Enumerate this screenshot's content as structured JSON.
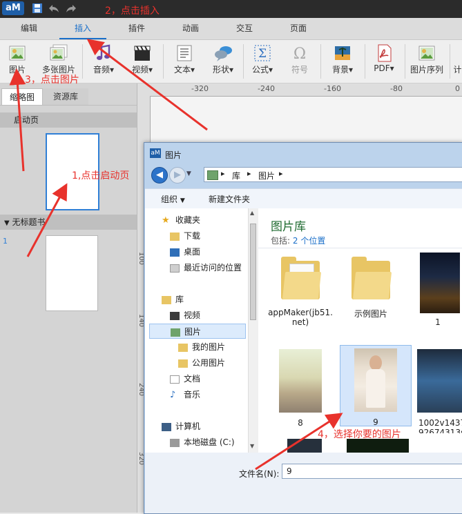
{
  "app": {
    "logo_text": "aM",
    "title_icons": [
      "save-icon",
      "undo-icon",
      "redo-icon"
    ]
  },
  "menu": {
    "tabs": [
      {
        "label": "编辑"
      },
      {
        "label": "插入",
        "active": true
      },
      {
        "label": "插件"
      },
      {
        "label": "动画"
      },
      {
        "label": "交互"
      },
      {
        "label": "页面"
      }
    ]
  },
  "ribbon": {
    "image": "图片",
    "multi_image": "多张图片",
    "audio": "音频",
    "video": "视频",
    "text": "文本",
    "shape": "形状",
    "formula": "公式",
    "symbol": "符号",
    "background": "背景",
    "pdf": "PDF",
    "image_sequence": "图片序列",
    "cut_label": "计"
  },
  "left_panel": {
    "tab_thumbs": "缩略图",
    "tab_resources": "资源库",
    "start_page": "启动页",
    "untitled_section": "无标题书",
    "page_number": "1"
  },
  "ruler": {
    "ticks": [
      "-320",
      "-240",
      "-160",
      "-80",
      "0"
    ],
    "vticks": [
      "100",
      "140",
      "240",
      "320"
    ]
  },
  "dialog": {
    "title": "图片",
    "breadcrumb": [
      "库",
      "图片"
    ],
    "organize": "组织",
    "new_folder": "新建文件夹",
    "nav": {
      "favorites": "收藏夹",
      "downloads": "下载",
      "desktop": "桌面",
      "recent": "最近访问的位置",
      "libraries": "库",
      "videos": "视频",
      "pictures": "图片",
      "my_pictures": "我的图片",
      "public_pictures": "公用图片",
      "documents": "文档",
      "music": "音乐",
      "computer": "计算机",
      "local_disk": "本地磁盘 (C:)"
    },
    "library_title": "图片库",
    "includes_label": "包括:",
    "includes_link": "2 个位置",
    "files": [
      {
        "name": "appMaker(jb51.net)",
        "name_line1": "appMaker(jb51.",
        "name_line2": "net)",
        "type": "folder"
      },
      {
        "name": "示例图片",
        "type": "folder"
      },
      {
        "name": "1",
        "type": "photo"
      },
      {
        "name": "8",
        "type": "photo"
      },
      {
        "name": "9",
        "type": "photo",
        "selected": true
      },
      {
        "name": "1002v1437926743135",
        "name_line1": "1002v1437",
        "name_line2": "92674313s",
        "type": "photo"
      }
    ],
    "filename_label": "文件名(N):",
    "filename_value": "9"
  },
  "annotations": {
    "step1": "1,点击启动页",
    "step2": "2，点击插入",
    "step3": "3，点击图片",
    "step4": "4，选择你要的图片"
  },
  "colors": {
    "accent": "#1a6fc9",
    "annotation": "#e8322c",
    "titlebar": "#2b2b2b"
  }
}
